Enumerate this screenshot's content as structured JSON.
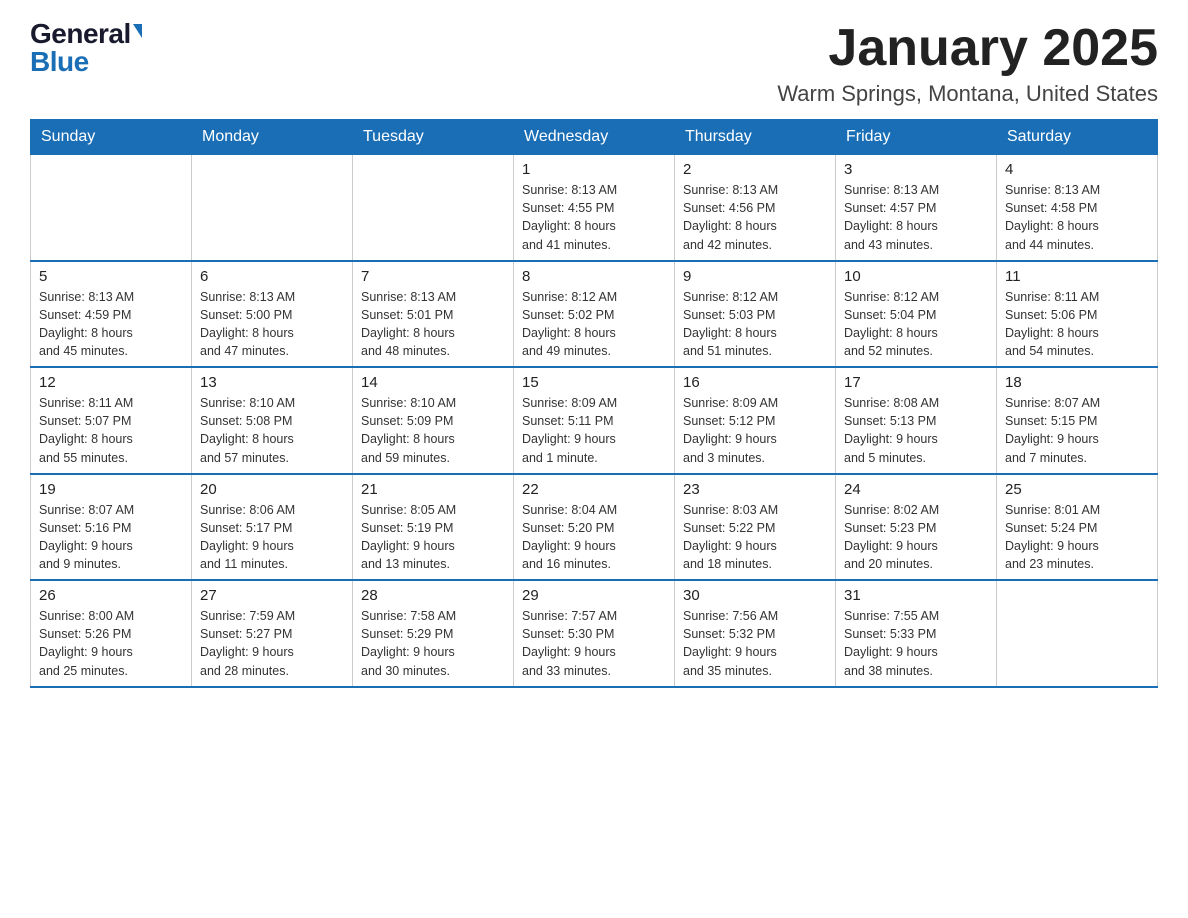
{
  "logo": {
    "general": "General",
    "blue": "Blue"
  },
  "header": {
    "month": "January 2025",
    "location": "Warm Springs, Montana, United States"
  },
  "days_of_week": [
    "Sunday",
    "Monday",
    "Tuesday",
    "Wednesday",
    "Thursday",
    "Friday",
    "Saturday"
  ],
  "weeks": [
    [
      {
        "day": "",
        "info": ""
      },
      {
        "day": "",
        "info": ""
      },
      {
        "day": "",
        "info": ""
      },
      {
        "day": "1",
        "info": "Sunrise: 8:13 AM\nSunset: 4:55 PM\nDaylight: 8 hours\nand 41 minutes."
      },
      {
        "day": "2",
        "info": "Sunrise: 8:13 AM\nSunset: 4:56 PM\nDaylight: 8 hours\nand 42 minutes."
      },
      {
        "day": "3",
        "info": "Sunrise: 8:13 AM\nSunset: 4:57 PM\nDaylight: 8 hours\nand 43 minutes."
      },
      {
        "day": "4",
        "info": "Sunrise: 8:13 AM\nSunset: 4:58 PM\nDaylight: 8 hours\nand 44 minutes."
      }
    ],
    [
      {
        "day": "5",
        "info": "Sunrise: 8:13 AM\nSunset: 4:59 PM\nDaylight: 8 hours\nand 45 minutes."
      },
      {
        "day": "6",
        "info": "Sunrise: 8:13 AM\nSunset: 5:00 PM\nDaylight: 8 hours\nand 47 minutes."
      },
      {
        "day": "7",
        "info": "Sunrise: 8:13 AM\nSunset: 5:01 PM\nDaylight: 8 hours\nand 48 minutes."
      },
      {
        "day": "8",
        "info": "Sunrise: 8:12 AM\nSunset: 5:02 PM\nDaylight: 8 hours\nand 49 minutes."
      },
      {
        "day": "9",
        "info": "Sunrise: 8:12 AM\nSunset: 5:03 PM\nDaylight: 8 hours\nand 51 minutes."
      },
      {
        "day": "10",
        "info": "Sunrise: 8:12 AM\nSunset: 5:04 PM\nDaylight: 8 hours\nand 52 minutes."
      },
      {
        "day": "11",
        "info": "Sunrise: 8:11 AM\nSunset: 5:06 PM\nDaylight: 8 hours\nand 54 minutes."
      }
    ],
    [
      {
        "day": "12",
        "info": "Sunrise: 8:11 AM\nSunset: 5:07 PM\nDaylight: 8 hours\nand 55 minutes."
      },
      {
        "day": "13",
        "info": "Sunrise: 8:10 AM\nSunset: 5:08 PM\nDaylight: 8 hours\nand 57 minutes."
      },
      {
        "day": "14",
        "info": "Sunrise: 8:10 AM\nSunset: 5:09 PM\nDaylight: 8 hours\nand 59 minutes."
      },
      {
        "day": "15",
        "info": "Sunrise: 8:09 AM\nSunset: 5:11 PM\nDaylight: 9 hours\nand 1 minute."
      },
      {
        "day": "16",
        "info": "Sunrise: 8:09 AM\nSunset: 5:12 PM\nDaylight: 9 hours\nand 3 minutes."
      },
      {
        "day": "17",
        "info": "Sunrise: 8:08 AM\nSunset: 5:13 PM\nDaylight: 9 hours\nand 5 minutes."
      },
      {
        "day": "18",
        "info": "Sunrise: 8:07 AM\nSunset: 5:15 PM\nDaylight: 9 hours\nand 7 minutes."
      }
    ],
    [
      {
        "day": "19",
        "info": "Sunrise: 8:07 AM\nSunset: 5:16 PM\nDaylight: 9 hours\nand 9 minutes."
      },
      {
        "day": "20",
        "info": "Sunrise: 8:06 AM\nSunset: 5:17 PM\nDaylight: 9 hours\nand 11 minutes."
      },
      {
        "day": "21",
        "info": "Sunrise: 8:05 AM\nSunset: 5:19 PM\nDaylight: 9 hours\nand 13 minutes."
      },
      {
        "day": "22",
        "info": "Sunrise: 8:04 AM\nSunset: 5:20 PM\nDaylight: 9 hours\nand 16 minutes."
      },
      {
        "day": "23",
        "info": "Sunrise: 8:03 AM\nSunset: 5:22 PM\nDaylight: 9 hours\nand 18 minutes."
      },
      {
        "day": "24",
        "info": "Sunrise: 8:02 AM\nSunset: 5:23 PM\nDaylight: 9 hours\nand 20 minutes."
      },
      {
        "day": "25",
        "info": "Sunrise: 8:01 AM\nSunset: 5:24 PM\nDaylight: 9 hours\nand 23 minutes."
      }
    ],
    [
      {
        "day": "26",
        "info": "Sunrise: 8:00 AM\nSunset: 5:26 PM\nDaylight: 9 hours\nand 25 minutes."
      },
      {
        "day": "27",
        "info": "Sunrise: 7:59 AM\nSunset: 5:27 PM\nDaylight: 9 hours\nand 28 minutes."
      },
      {
        "day": "28",
        "info": "Sunrise: 7:58 AM\nSunset: 5:29 PM\nDaylight: 9 hours\nand 30 minutes."
      },
      {
        "day": "29",
        "info": "Sunrise: 7:57 AM\nSunset: 5:30 PM\nDaylight: 9 hours\nand 33 minutes."
      },
      {
        "day": "30",
        "info": "Sunrise: 7:56 AM\nSunset: 5:32 PM\nDaylight: 9 hours\nand 35 minutes."
      },
      {
        "day": "31",
        "info": "Sunrise: 7:55 AM\nSunset: 5:33 PM\nDaylight: 9 hours\nand 38 minutes."
      },
      {
        "day": "",
        "info": ""
      }
    ]
  ]
}
